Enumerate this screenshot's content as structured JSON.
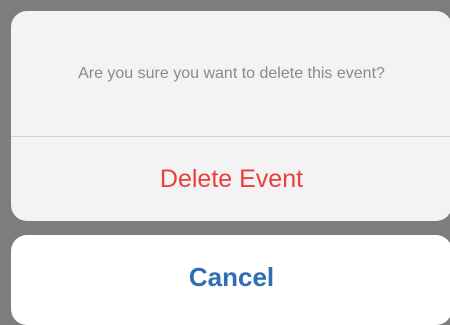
{
  "dialog": {
    "message": "Are you sure you want to delete this event?",
    "destructive_label": "Delete Event",
    "cancel_label": "Cancel"
  },
  "colors": {
    "backdrop": "#7d7d7d",
    "sheet": "#f3f3f3",
    "cancel_sheet": "#ffffff",
    "message_text": "#8a8a8a",
    "destructive": "#e8413d",
    "cancel": "#2f6db5",
    "divider": "#d2d2d2"
  }
}
